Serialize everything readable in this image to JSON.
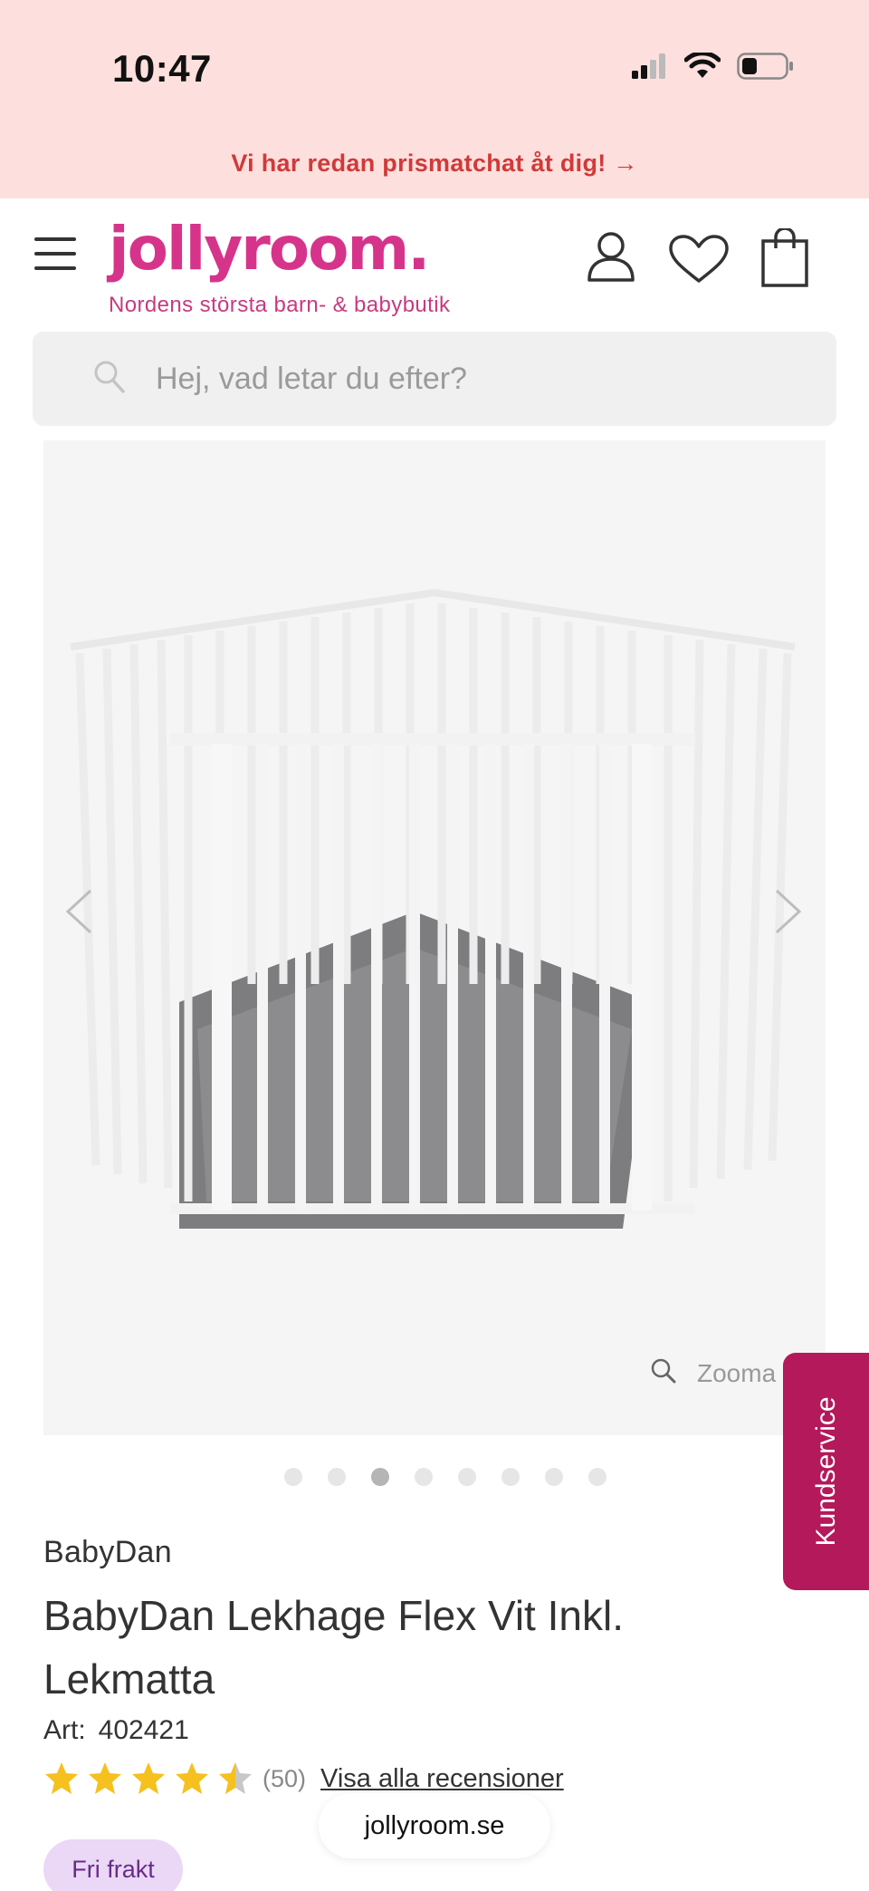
{
  "status_bar": {
    "time": "10:47",
    "icons": [
      "cellular-signal-icon",
      "wifi-icon",
      "battery-icon"
    ]
  },
  "promo_banner": {
    "text": "Vi har redan prismatchat åt dig! →"
  },
  "header": {
    "logo": "jollyroom.",
    "tagline": "Nordens största barn- & babybutik",
    "icons": [
      "menu-icon",
      "account-icon",
      "wishlist-heart-icon",
      "shopping-bag-icon"
    ]
  },
  "search": {
    "placeholder": "Hej, vad letar du efter?"
  },
  "gallery": {
    "image_subject": "playpen-image",
    "zoom_label": "Zooma",
    "dot_count": 8,
    "active_dot": 3
  },
  "kundservice": {
    "label": "Kundservice"
  },
  "product": {
    "brand": "BabyDan",
    "title": "BabyDan Lekhage Flex Vit Inkl. Lekmatta",
    "art_label": "Art:",
    "art_number": "402421",
    "rating": 4.5,
    "review_count": "(50)",
    "reviews_link": "Visa alla recensioner",
    "badge": "Fri frakt"
  },
  "browser": {
    "domain": "jollyroom.se"
  },
  "colors": {
    "promo_bg": "#fde0dd",
    "promo_text": "#d03a3a",
    "brand_pink": "#d6348b",
    "kundservice_bg": "#b3195b",
    "star": "#f6c01e",
    "badge_bg": "#ead8f6"
  }
}
